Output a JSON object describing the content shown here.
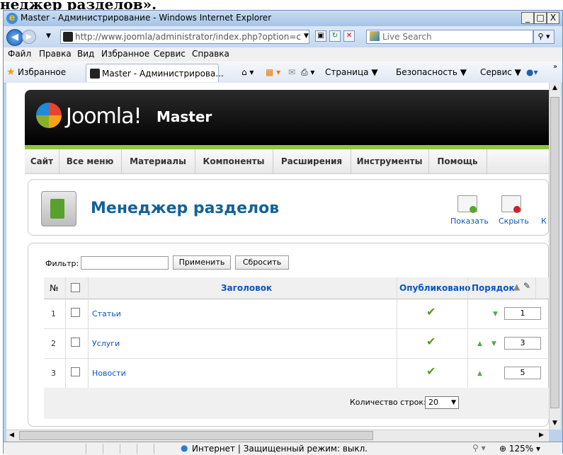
{
  "document": {
    "heading_fragment": "неджер разделов»."
  },
  "window": {
    "title": "Master - Администрирование - Windows Internet Explorer"
  },
  "browser": {
    "url": "http://www.joomla/administrator/index.php?option=c",
    "search_placeholder": "Live Search",
    "menu": [
      "Файл",
      "Правка",
      "Вид",
      "Избранное",
      "Сервис",
      "Справка"
    ],
    "favorites_label": "Избранное",
    "tab_label": "Master - Администрирова...",
    "commands": [
      "Страница ▼",
      "Безопасность ▼",
      "Сервис ▼"
    ],
    "status_text": "Интернет | Защищенный режим: выкл.",
    "zoom": "125%"
  },
  "joomla": {
    "brand": "Joomla!",
    "site_name": "Master",
    "menu": [
      "Сайт",
      "Все меню",
      "Материалы",
      "Компоненты",
      "Расширения",
      "Инструменты",
      "Помощь"
    ],
    "page_title": "Менеджер разделов",
    "toolbar": {
      "show": "Показать",
      "hide": "Скрыть",
      "more": "К"
    },
    "filter": {
      "label": "Фильтр:",
      "apply": "Применить",
      "reset": "Сбросить"
    },
    "columns": {
      "num": "№",
      "title": "Заголовок",
      "published": "Опубликовано",
      "order": "Порядок"
    },
    "rows": [
      {
        "num": "1",
        "title": "Статьи",
        "order": "1"
      },
      {
        "num": "2",
        "title": "Услуги",
        "order": "3"
      },
      {
        "num": "3",
        "title": "Новости",
        "order": "5"
      }
    ],
    "footer": {
      "rows_label": "Количество строк:",
      "rows_value": "20"
    }
  },
  "colors": {
    "joomla_green": "#8dc63f",
    "link_blue": "#0b55c4",
    "title_blue": "#146295"
  }
}
